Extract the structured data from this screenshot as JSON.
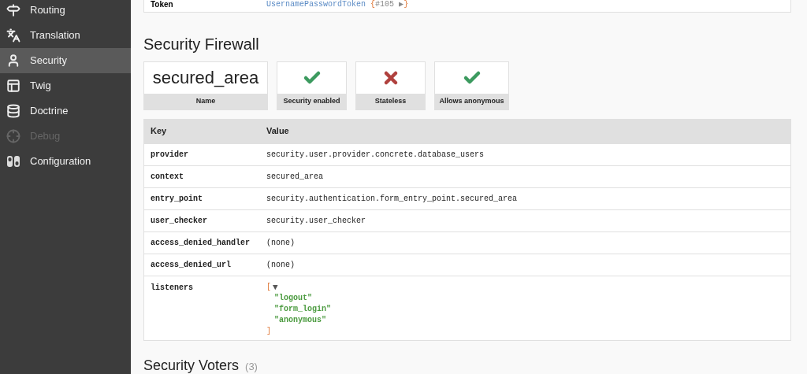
{
  "sidebar": {
    "items": [
      {
        "label": "Routing",
        "selected": false,
        "disabled": false
      },
      {
        "label": "Translation",
        "selected": false,
        "disabled": false
      },
      {
        "label": "Security",
        "selected": true,
        "disabled": false
      },
      {
        "label": "Twig",
        "selected": false,
        "disabled": false
      },
      {
        "label": "Doctrine",
        "selected": false,
        "disabled": false
      },
      {
        "label": "Debug",
        "selected": false,
        "disabled": true
      },
      {
        "label": "Configuration",
        "selected": false,
        "disabled": false
      }
    ]
  },
  "token_row": {
    "key": "Token",
    "class": "UsernamePasswordToken",
    "open_brace": "{",
    "ref": "#105",
    "toggle": "▶",
    "close_brace": "}"
  },
  "firewall": {
    "title": "Security Firewall",
    "cards": [
      {
        "kind": "text",
        "value": "secured_area",
        "label": "Name"
      },
      {
        "kind": "flag",
        "on": true,
        "label": "Security enabled"
      },
      {
        "kind": "flag",
        "on": false,
        "label": "Stateless"
      },
      {
        "kind": "flag",
        "on": true,
        "label": "Allows anonymous"
      }
    ],
    "table": {
      "columns": [
        "Key",
        "Value"
      ],
      "rows": [
        {
          "key": "provider",
          "kind": "text",
          "value": "security.user.provider.concrete.database_users"
        },
        {
          "key": "context",
          "kind": "text",
          "value": "secured_area"
        },
        {
          "key": "entry_point",
          "kind": "text",
          "value": "security.authentication.form_entry_point.secured_area"
        },
        {
          "key": "user_checker",
          "kind": "text",
          "value": "security.user_checker"
        },
        {
          "key": "access_denied_handler",
          "kind": "text",
          "value": "(none)"
        },
        {
          "key": "access_denied_url",
          "kind": "text",
          "value": "(none)"
        },
        {
          "key": "listeners",
          "kind": "list",
          "open": "[",
          "toggle": "▼",
          "expanded": true,
          "items": [
            "\"logout\"",
            "\"form_login\"",
            "\"anonymous\""
          ],
          "close": "]"
        }
      ]
    }
  },
  "voters": {
    "title": "Security Voters",
    "count": "(3)"
  }
}
